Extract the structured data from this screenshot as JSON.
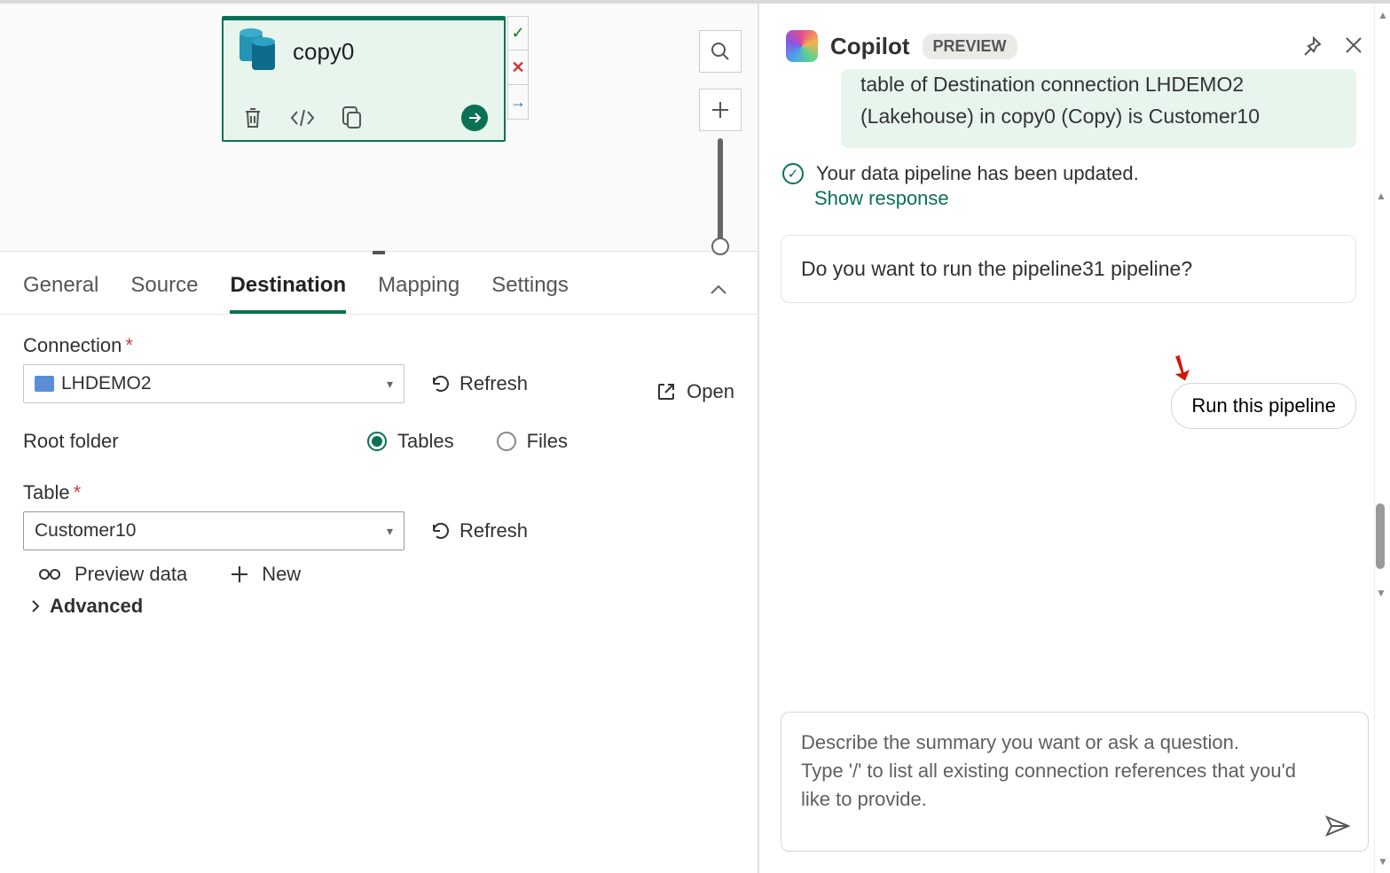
{
  "canvas": {
    "node": {
      "title": "copy0",
      "status_ok": "green-check",
      "status_err": "red-x",
      "status_skip": "blue-arrow"
    }
  },
  "tabs": {
    "items": [
      "General",
      "Source",
      "Destination",
      "Mapping",
      "Settings"
    ],
    "active_index": 2
  },
  "form": {
    "connection_label": "Connection",
    "connection_value": "LHDEMO2",
    "refresh_label": "Refresh",
    "open_label": "Open",
    "root_folder_label": "Root folder",
    "root_options": {
      "tables": "Tables",
      "files": "Files"
    },
    "root_selected": "tables",
    "table_label": "Table",
    "table_value": "Customer10",
    "preview_label": "Preview data",
    "new_label": "New",
    "advanced_label": "Advanced"
  },
  "copilot": {
    "title": "Copilot",
    "badge": "PREVIEW",
    "message_partial": "table of Destination connection LHDEMO2 (Lakehouse) in copy0 (Copy) is Customer10",
    "status_msg": "Your data pipeline has been updated.",
    "show_response": "Show response",
    "prompt_question": "Do you want to run the pipeline31 pipeline?",
    "run_button": "Run this pipeline",
    "composer_placeholder_1": "Describe the summary you want or ask a question.",
    "composer_placeholder_2": "Type '/' to list all existing connection references that you'd like to provide."
  }
}
